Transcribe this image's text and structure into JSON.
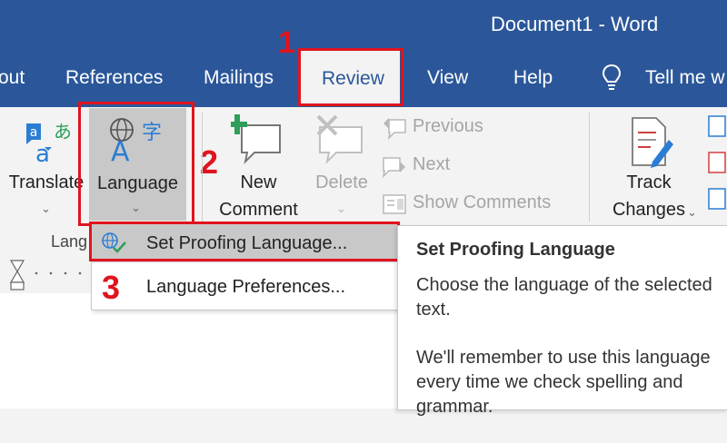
{
  "window": {
    "title": "Document1  -  Word"
  },
  "tabs": [
    {
      "label": "out"
    },
    {
      "label": "References"
    },
    {
      "label": "Mailings"
    },
    {
      "label": "Review",
      "active": true
    },
    {
      "label": "View"
    },
    {
      "label": "Help"
    },
    {
      "label": "Tell me w",
      "icon": "lightbulb-icon"
    }
  ],
  "ribbon": {
    "translate_label": "Translate",
    "language_label": "Language",
    "new_comment_line1": "New",
    "new_comment_line2": "Comment",
    "delete_label": "Delete",
    "previous_label": "Previous",
    "next_label": "Next",
    "show_comments_label": "Show Comments",
    "track_line1": "Track",
    "track_line2": "Changes",
    "language_group_label": "Lang"
  },
  "dropdown": {
    "items": [
      {
        "label": "Set Proofing Language...",
        "icon": "proofing-language-icon",
        "highlighted": true
      },
      {
        "label": "Language Preferences..."
      }
    ]
  },
  "tooltip": {
    "title": "Set Proofing Language",
    "paragraphs": [
      "Choose the language of the selected text.",
      "We'll remember to use this language every time we check spelling and grammar."
    ]
  },
  "annotations": {
    "step1": "1",
    "step2": "2",
    "step3": "3"
  },
  "colors": {
    "brand": "#2b579a",
    "annotation": "#e0141e",
    "ribbon": "#f3f3f3",
    "accent_green": "#2e9e5b"
  }
}
